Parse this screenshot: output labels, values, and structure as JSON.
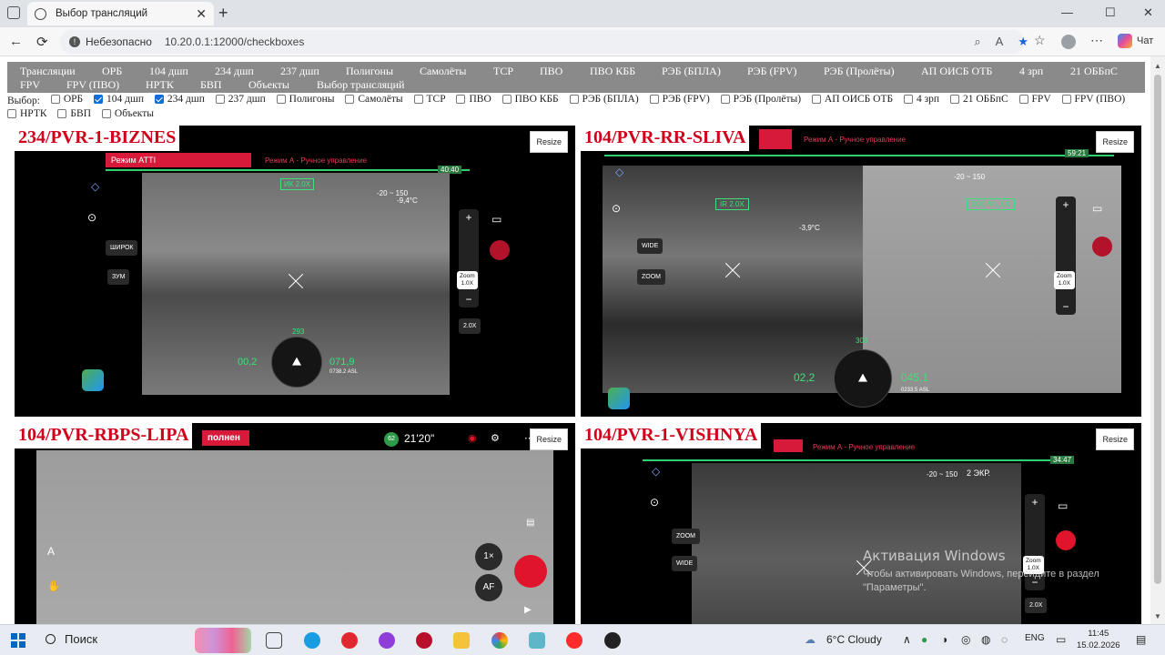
{
  "browser": {
    "tab_title": "Выбор трансляций",
    "tab_close": "✕",
    "new_tab": "+",
    "minimize": "—",
    "maximize": "☐",
    "close": "✕",
    "back": "←",
    "reload": "⟳",
    "insecure_label": "Небезопасно",
    "url": "10.20.0.1:12000/checkboxes",
    "copilot_label": "Чат"
  },
  "nav_menu": [
    "Трансляции",
    "ОРБ",
    "104 дшп",
    "234 дшп",
    "237 дшп",
    "Полигоны",
    "Самолёты",
    "ТСР",
    "ПВО",
    "ПВО КББ",
    "РЭБ (БПЛА)",
    "РЭБ (FPV)",
    "РЭБ (Пролёты)",
    "АП ОИСБ ОТБ",
    "4 зрп",
    "21 ОББпС",
    "FPV",
    "FPV (ПВО)",
    "НРТК",
    "БВП",
    "Объекты",
    "Выбор трансляций"
  ],
  "filters": {
    "prefix": "Выбор:",
    "items": [
      {
        "label": "ОРБ",
        "checked": false
      },
      {
        "label": "104 дшп",
        "checked": true
      },
      {
        "label": "234 дшп",
        "checked": true
      },
      {
        "label": "237 дшп",
        "checked": false
      },
      {
        "label": "Полигоны",
        "checked": false
      },
      {
        "label": "Самолёты",
        "checked": false
      },
      {
        "label": "ТСР",
        "checked": false
      },
      {
        "label": "ПВО",
        "checked": false
      },
      {
        "label": "ПВО КББ",
        "checked": false
      },
      {
        "label": "РЭБ (БПЛА)",
        "checked": false
      },
      {
        "label": "РЭБ (FPV)",
        "checked": false
      },
      {
        "label": "РЭБ (Пролёты)",
        "checked": false
      },
      {
        "label": "АП ОИСБ ОТБ",
        "checked": false
      },
      {
        "label": "4 зрп",
        "checked": false
      },
      {
        "label": "21 ОББпС",
        "checked": false
      },
      {
        "label": "FPV",
        "checked": false
      },
      {
        "label": "FPV (ПВО)",
        "checked": false
      },
      {
        "label": "НРТК",
        "checked": false
      },
      {
        "label": "БВП",
        "checked": false
      },
      {
        "label": "Объекты",
        "checked": false
      }
    ]
  },
  "streams": [
    {
      "name": "234/PVR-1-BIZNES",
      "resize_label": "Resize",
      "mode_bar": "Режим ATTI",
      "manual_mode": "Режим А - Ручное управление",
      "timer": "40:40",
      "ir_zoom": "ИК 2.0X",
      "range": "-20 ~ 150",
      "temp": "-9,4°C",
      "btn_wide": "ШИРОК",
      "btn_zoom": "ЗУМ",
      "zoom_label": "Zoom\n1.0X",
      "zoom_value": "2.0X",
      "speed": "00,2",
      "altitude": "071,9",
      "asl": "0738.2 ASL",
      "heading": "293"
    },
    {
      "name": "104/PVR-RR-SLIVA",
      "resize_label": "Resize",
      "manual_mode": "Режим А - Ручное управление",
      "timer": "59:21",
      "ir_zoom": "IR 2.0X",
      "zoom_box": "ZOOM 1.0X",
      "temp": "-3,9°C",
      "range": "-20 ~ 150",
      "btn_wide": "WIDE",
      "btn_zoom": "ZOOM",
      "zoom_label": "Zoom\n1.0X",
      "speed": "02,2",
      "altitude": "045,1",
      "asl": "0233.5 ASL",
      "heading": "303"
    },
    {
      "name": "104/PVR-RBPS-LIPA",
      "resize_label": "Resize",
      "red_bar": "полнен",
      "time": "21'20\"",
      "badge": "62",
      "btn_1x": "1×",
      "btn_af": "AF"
    },
    {
      "name": "104/PVR-1-VISHNYA",
      "resize_label": "Resize",
      "manual_mode": "Режим А - Ручное управление",
      "timer": "34:47",
      "range": "-20 ~ 150",
      "screens": "2 ЭКР.",
      "btn_zoom": "ZOOM",
      "btn_wide": "WIDE",
      "zoom_label": "Zoom\n1.0X",
      "zoom_value": "2.0X"
    }
  ],
  "watermark": {
    "title": "Активация Windows",
    "subtitle": "Чтобы активировать Windows, перейдите в раздел \"Параметры\"."
  },
  "taskbar": {
    "search_label": "Поиск",
    "weather": "6°C  Cloudy",
    "lang": "ENG",
    "time": "11:45",
    "date": "15.02.2026"
  }
}
